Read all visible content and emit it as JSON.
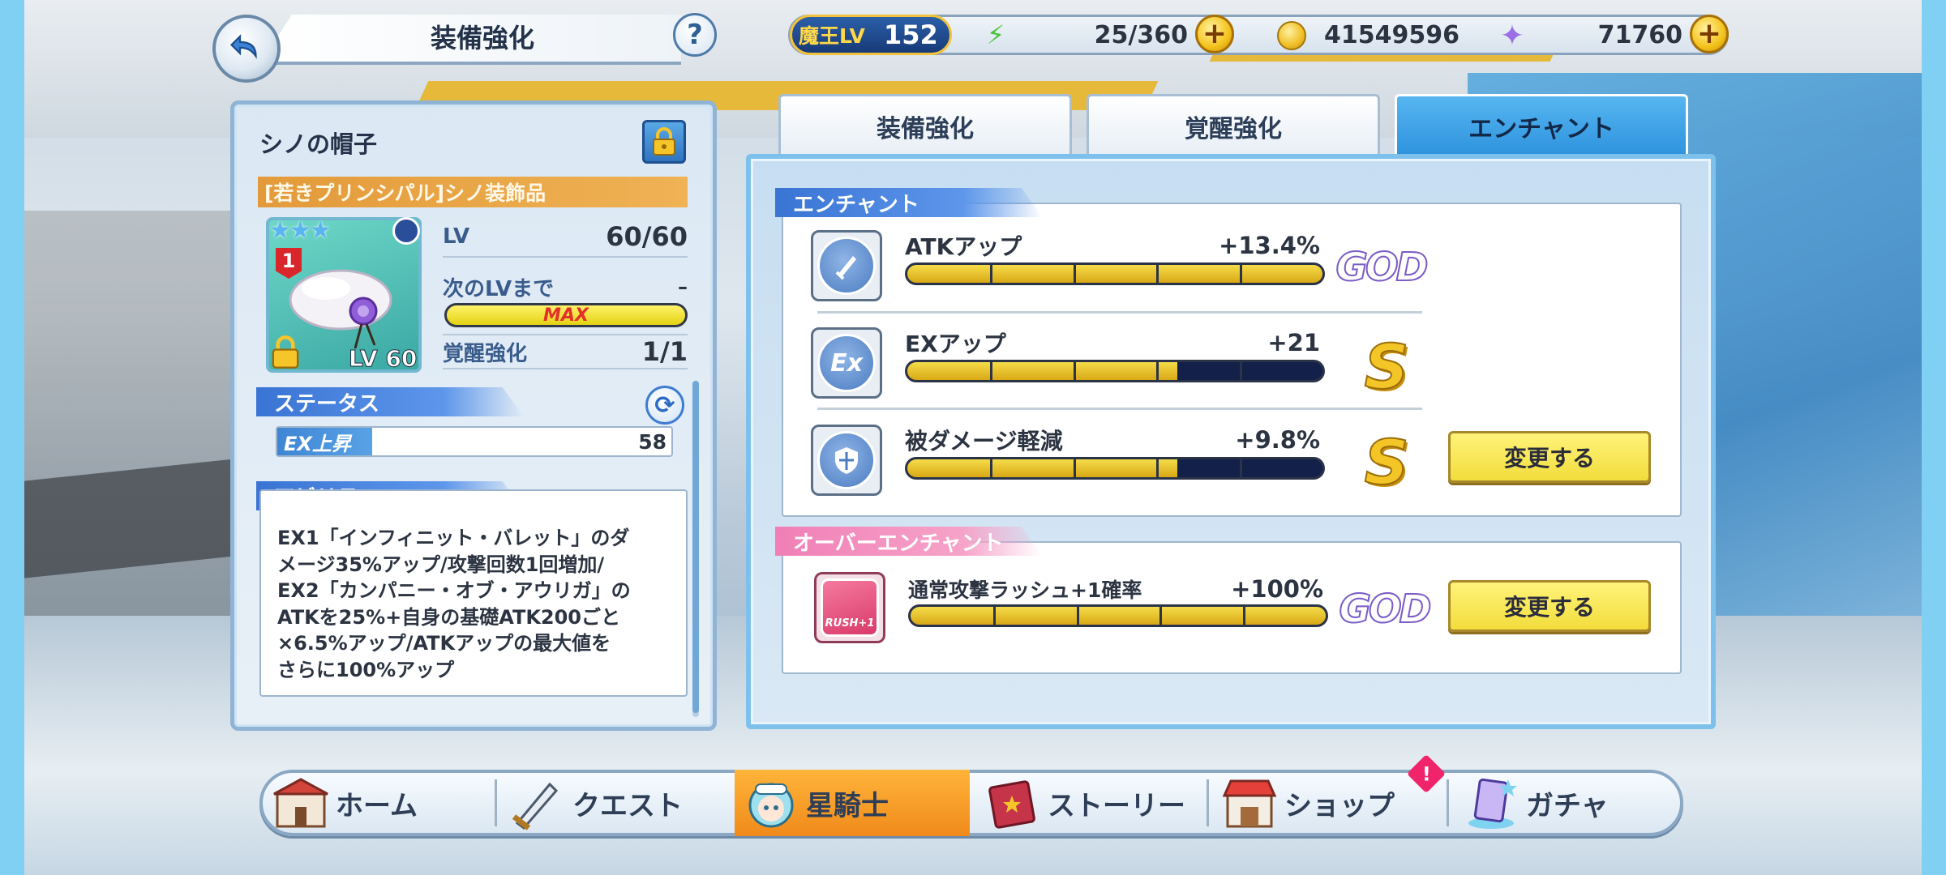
{
  "header": {
    "title": "装備強化",
    "help": "?",
    "player_level_label": "魔王LV",
    "player_level": "152",
    "stamina": "25/360",
    "coins": "41549596",
    "gems": "71760",
    "plus": "+"
  },
  "item": {
    "name": "シノの帽子",
    "series": "[若きプリンシパル]シノ装飾品",
    "stars": "★★★",
    "rank": "1",
    "card_level": "LV 60",
    "lv_label": "LV",
    "lv_value": "60/60",
    "next_lv_label": "次のLVまで",
    "next_lv_value": "–",
    "next_lv_bar_text": "MAX",
    "awaken_label": "覚醒強化",
    "awaken_value": "1/1"
  },
  "status": {
    "header": "ステータス",
    "name": "EX上昇",
    "value": "58",
    "fill_fraction": 0.24
  },
  "ability": {
    "header": "アビリティ",
    "text": "EX1「インフィニット・バレット」のダ\nメージ35%アップ/攻撃回数1回増加/\nEX2「カンパニー・オブ・アウリガ」の\nATKを25%+自身の基礎ATK200ごと\n×6.5%アップ/ATKアップの最大値を\nさらに100%アップ"
  },
  "tabs": [
    {
      "label": "装備強化",
      "active": false
    },
    {
      "label": "覚醒強化",
      "active": false
    },
    {
      "label": "エンチャント",
      "active": true
    }
  ],
  "enchant": {
    "header": "エンチャント",
    "rows": [
      {
        "name": "ATKアップ",
        "value": "+13.4%",
        "fill_fraction": 1.0,
        "grade": "GOD",
        "icon": "sword-icon",
        "icon_text": ""
      },
      {
        "name": "EXアップ",
        "value": "+21",
        "fill_fraction": 0.65,
        "grade": "S",
        "icon": "ex-icon",
        "icon_text": "Ex"
      },
      {
        "name": "被ダメージ軽減",
        "value": "+9.8%",
        "fill_fraction": 0.65,
        "grade": "S",
        "icon": "shield-icon",
        "icon_text": "",
        "button": "変更する"
      }
    ]
  },
  "over_enchant": {
    "header": "オーバーエンチャント",
    "name": "通常攻撃ラッシュ+1確率",
    "value": "+100%",
    "fill_fraction": 1.0,
    "grade": "GOD",
    "icon_text": "RUSH+1",
    "button": "変更する"
  },
  "nav": [
    {
      "label": "ホーム",
      "icon": "home-building-icon"
    },
    {
      "label": "クエスト",
      "icon": "sword-quest-icon"
    },
    {
      "label": "星騎士",
      "icon": "character-face-icon",
      "active": true
    },
    {
      "label": "ストーリー",
      "icon": "story-book-icon"
    },
    {
      "label": "ショップ",
      "icon": "shop-icon",
      "badge": "!"
    },
    {
      "label": "ガチャ",
      "icon": "gacha-card-icon"
    }
  ],
  "colors": {
    "accent_blue": "#3a74d4",
    "tab_active": "#2f93de",
    "button_yellow": "#f2dd3c",
    "nav_active": "#f08a1a",
    "bar_gold": "#d9a815"
  }
}
